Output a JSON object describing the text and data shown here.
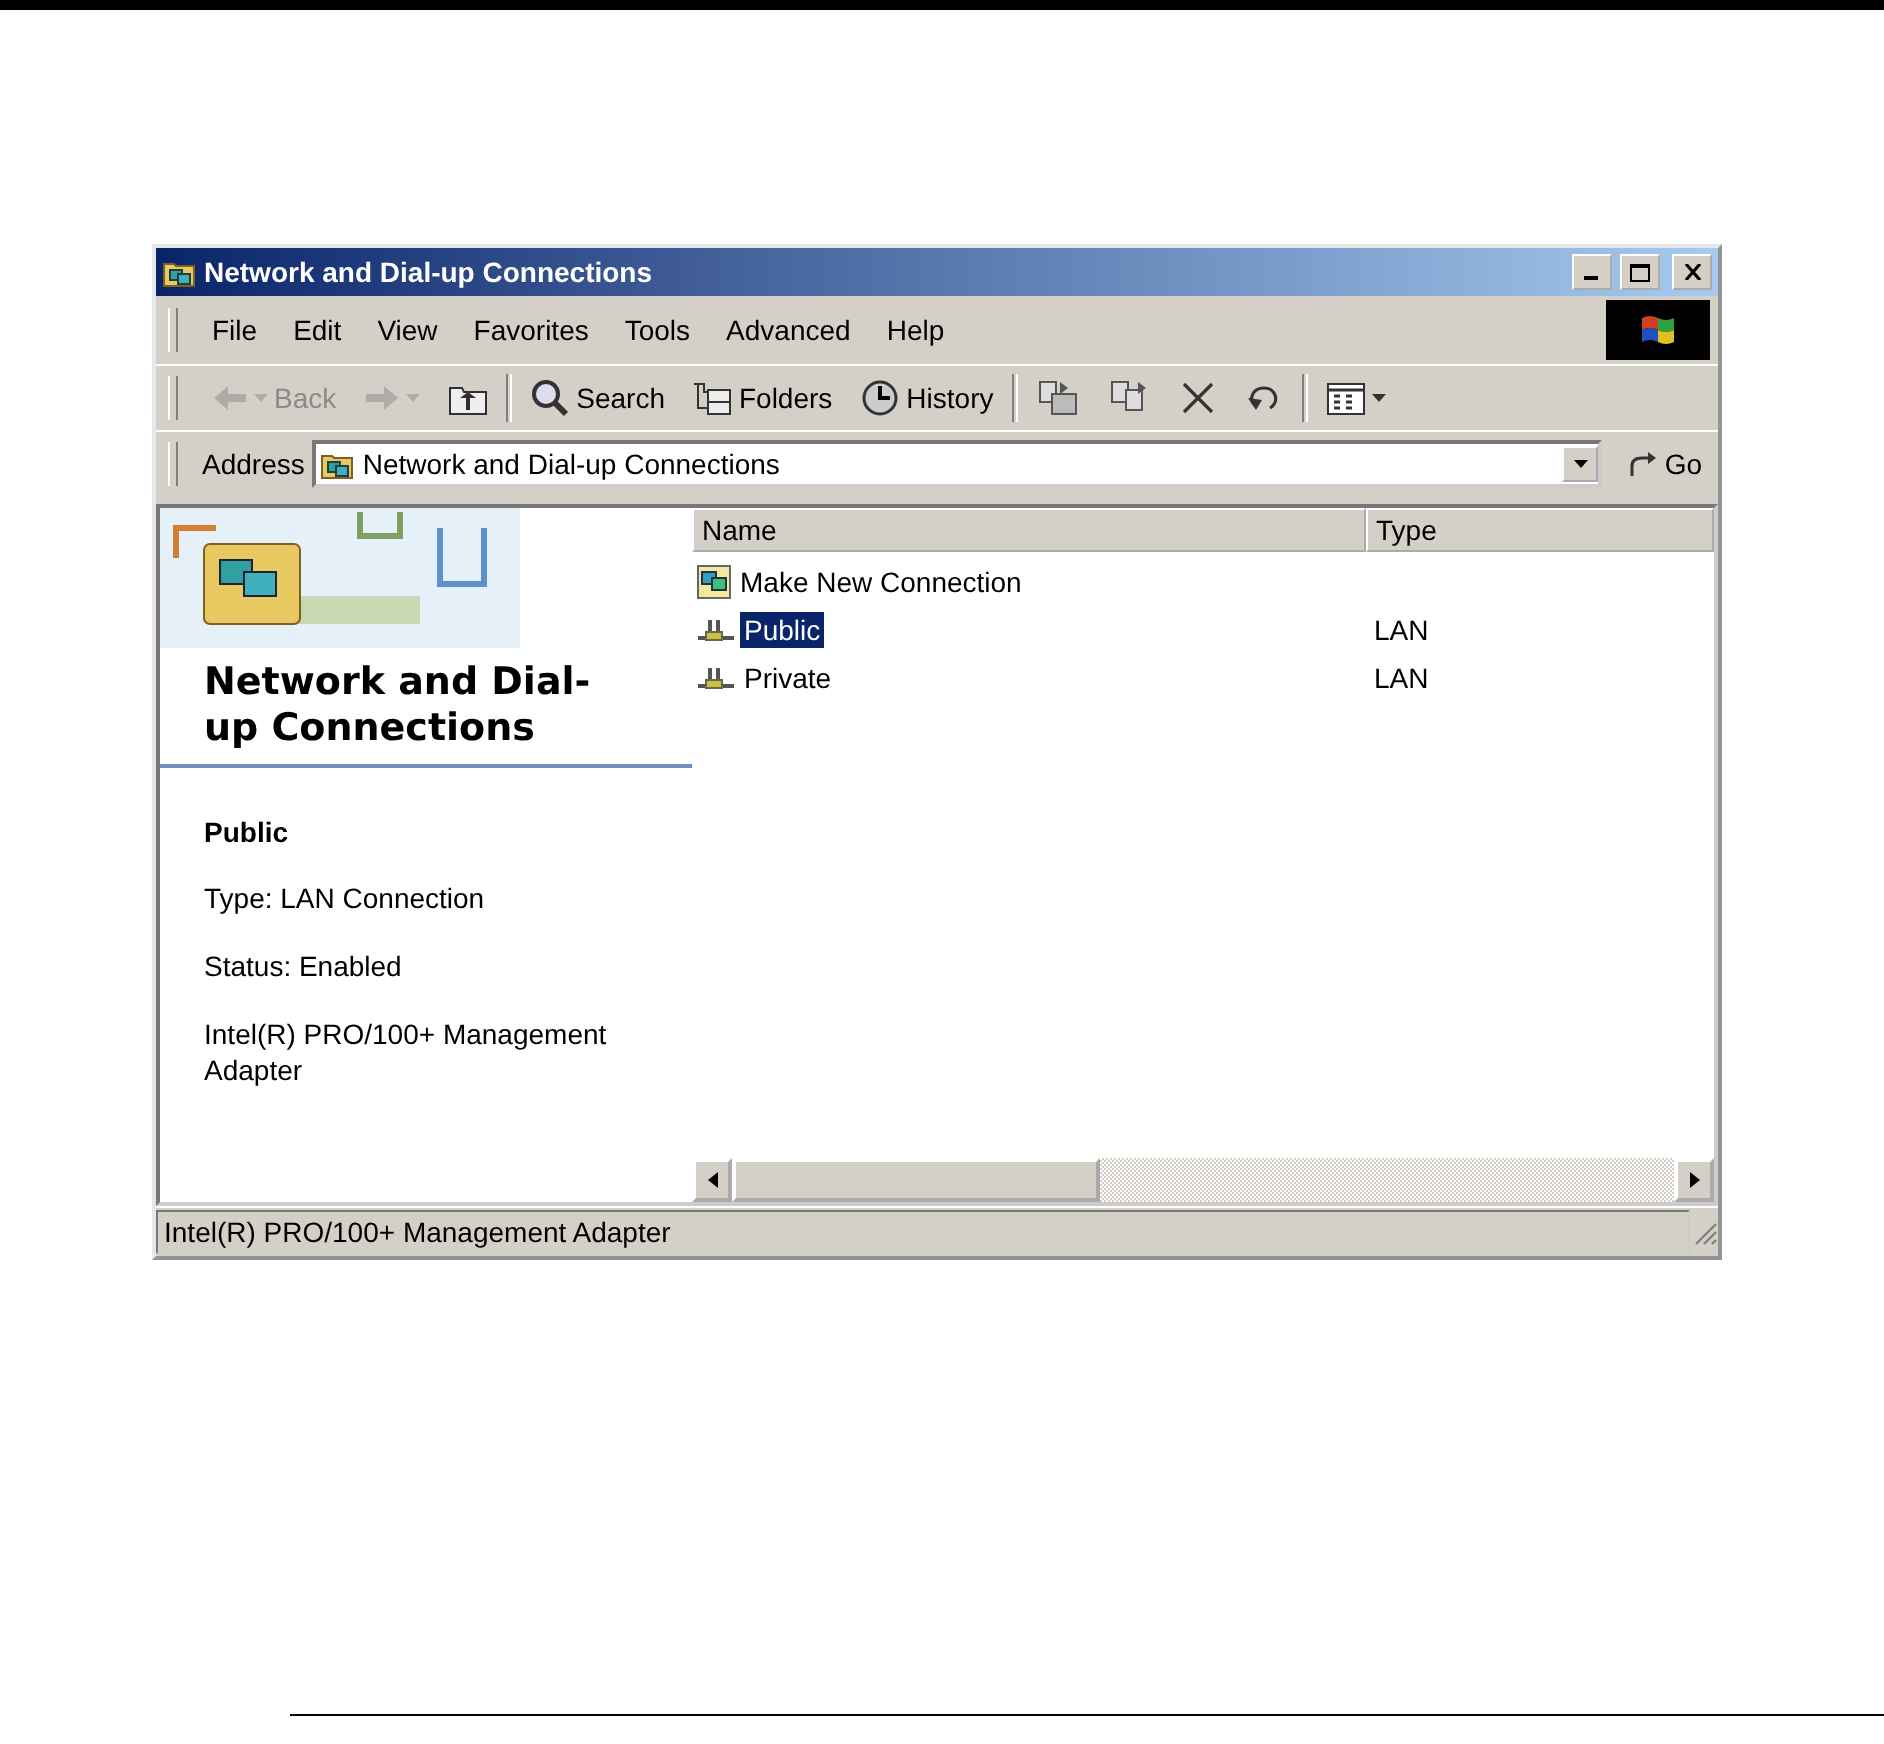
{
  "window": {
    "title": "Network and Dial-up Connections"
  },
  "menu": {
    "items": [
      "File",
      "Edit",
      "View",
      "Favorites",
      "Tools",
      "Advanced",
      "Help"
    ]
  },
  "toolbar": {
    "buttons": [
      {
        "kind": "back",
        "label": "Back",
        "disabled": true
      },
      {
        "kind": "forward",
        "disabled": true
      },
      {
        "kind": "up",
        "disabled": false
      },
      {
        "kind": "search",
        "label": "Search",
        "disabled": false
      },
      {
        "kind": "folders",
        "label": "Folders",
        "disabled": false
      },
      {
        "kind": "history",
        "label": "History",
        "disabled": false
      },
      {
        "kind": "move",
        "disabled": false
      },
      {
        "kind": "copy",
        "disabled": false
      },
      {
        "kind": "delete",
        "disabled": false
      },
      {
        "kind": "undo",
        "disabled": false
      },
      {
        "kind": "views",
        "disabled": false
      }
    ]
  },
  "address": {
    "label": "Address",
    "value": "Network and Dial-up Connections",
    "go": "Go"
  },
  "info_pane": {
    "heading": "Network and Dial-up Connections",
    "selected_name": "Public",
    "details": [
      "Type: LAN Connection",
      "Status: Enabled",
      "Intel(R) PRO/100+ Management Adapter"
    ]
  },
  "list": {
    "columns": [
      "Name",
      "Type"
    ],
    "rows": [
      {
        "kind": "wizard",
        "name": "Make New Connection",
        "selected": false
      },
      {
        "kind": "lan",
        "name": "Public",
        "type": "LAN",
        "selected": true
      },
      {
        "kind": "lan",
        "name": "Private",
        "type": "LAN",
        "selected": false
      }
    ]
  },
  "status_bar": {
    "text": "Intel(R) PRO/100+ Management Adapter"
  }
}
